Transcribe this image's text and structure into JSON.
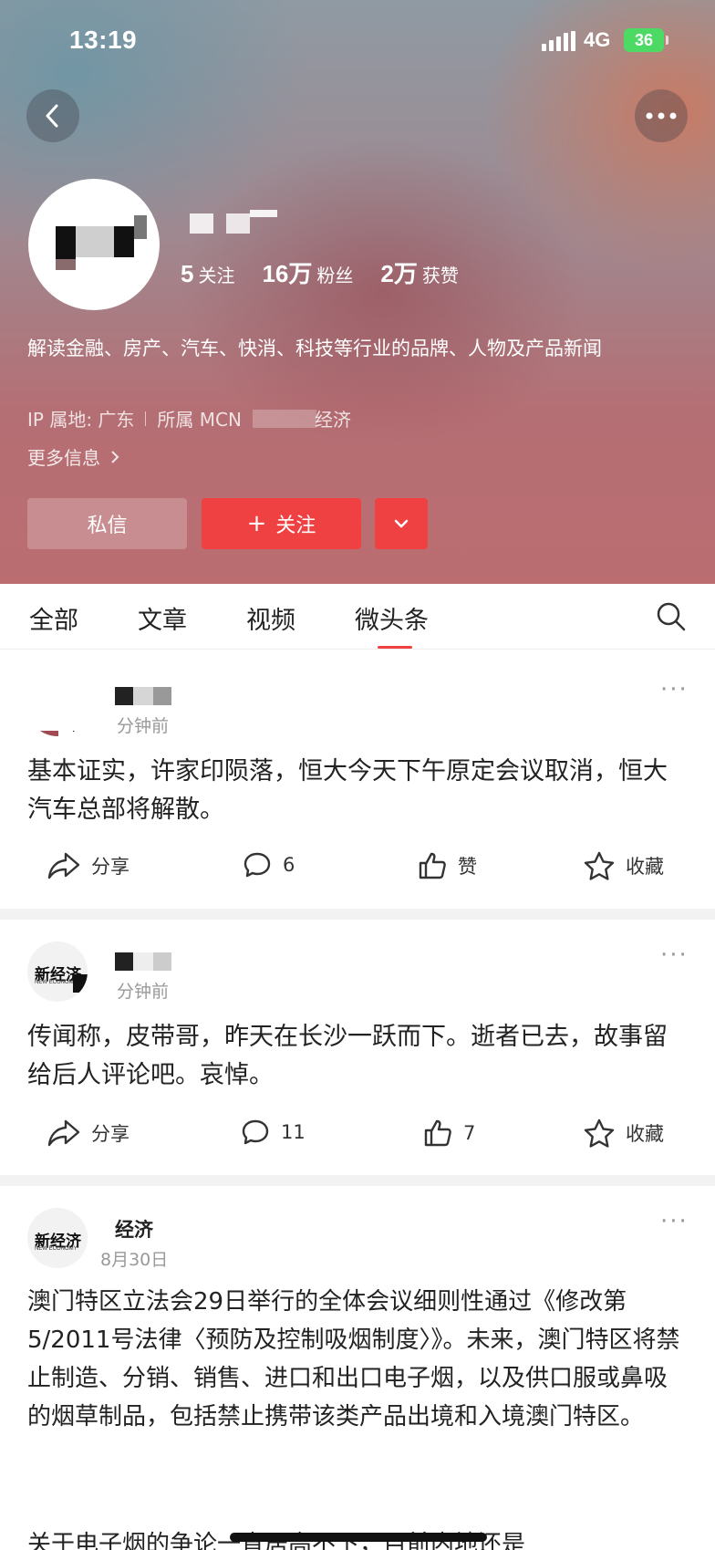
{
  "status_bar": {
    "time": "13:19",
    "network": "4G",
    "battery": "36"
  },
  "profile": {
    "stats": [
      {
        "num": "5",
        "label": "关注"
      },
      {
        "num": "16万",
        "label": "粉丝"
      },
      {
        "num": "2万",
        "label": "获赞"
      }
    ],
    "bio": "解读金融、房产、汽车、快消、科技等行业的品牌、人物及产品新闻",
    "ip_label": "IP 属地: 广东",
    "mcn_label": "所属 MCN",
    "mcn_suffix": "经济",
    "more_info": "更多信息",
    "message_button": "私信",
    "follow_button": "关注",
    "follow_plus": "+"
  },
  "tabs": [
    {
      "label": "全部",
      "active": false
    },
    {
      "label": "文章",
      "active": false
    },
    {
      "label": "视频",
      "active": false
    },
    {
      "label": "微头条",
      "active": true
    }
  ],
  "posts": [
    {
      "time": "分钟前",
      "text": "基本证实，许家印陨落，恒大今天下午原定会议取消，恒大汽车总部将解散。",
      "share": "分享",
      "comments": "6",
      "likes": "赞",
      "favorite": "收藏"
    },
    {
      "logo": "新经济",
      "logo_sub": "NEW ECONOMY",
      "time": "分钟前",
      "text": "传闻称，皮带哥，昨天在长沙一跃而下。逝者已去，故事留给后人评论吧。哀悼。",
      "share": "分享",
      "comments": "11",
      "likes": "7",
      "favorite": "收藏"
    },
    {
      "logo": "新经济",
      "logo_sub": "NEW ECONOMY",
      "name": "经济",
      "time": "8月30日",
      "text": "澳门特区立法会29日举行的全体会议细则性通过《修改第5/2011号法律〈预防及控制吸烟制度〉》。未来，澳门特区将禁止制造、分销、销售、进口和出口电子烟，以及供口服或鼻吸的烟草制品，包括禁止携带该类产品出境和入境澳门特区。",
      "text_cut": "关于电子烟的争论一直居高不下，目前内地还是"
    }
  ],
  "colors": {
    "accent": "#f04142",
    "muted": "#999999"
  }
}
